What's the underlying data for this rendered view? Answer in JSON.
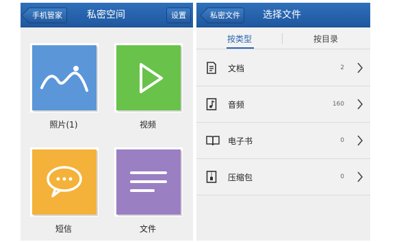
{
  "private_space": {
    "back_label": "手机管家",
    "title": "私密空间",
    "settings_label": "设置",
    "tiles": [
      {
        "label": "照片(1)",
        "icon": "photo-icon",
        "color": "#5b96d9"
      },
      {
        "label": "视频",
        "icon": "play-icon",
        "color": "#69c24a"
      },
      {
        "label": "短信",
        "icon": "chat-bubble-icon",
        "color": "#f4b23a"
      },
      {
        "label": "文件",
        "icon": "file-lines-icon",
        "color": "#9a7fc3"
      }
    ]
  },
  "select_file": {
    "back_label": "私密文件",
    "title": "选择文件",
    "tabs": [
      {
        "label": "按类型",
        "active": true
      },
      {
        "label": "按目录",
        "active": false
      }
    ],
    "items": [
      {
        "label": "文档",
        "count": "2",
        "icon": "document-icon"
      },
      {
        "label": "音频",
        "count": "160",
        "icon": "music-note-icon"
      },
      {
        "label": "电子书",
        "count": "0",
        "icon": "book-icon"
      },
      {
        "label": "压缩包",
        "count": "0",
        "icon": "zip-archive-icon"
      }
    ]
  },
  "colors": {
    "titlebar": "#2462a8",
    "accent": "#2a66b0",
    "background": "#efefef"
  }
}
